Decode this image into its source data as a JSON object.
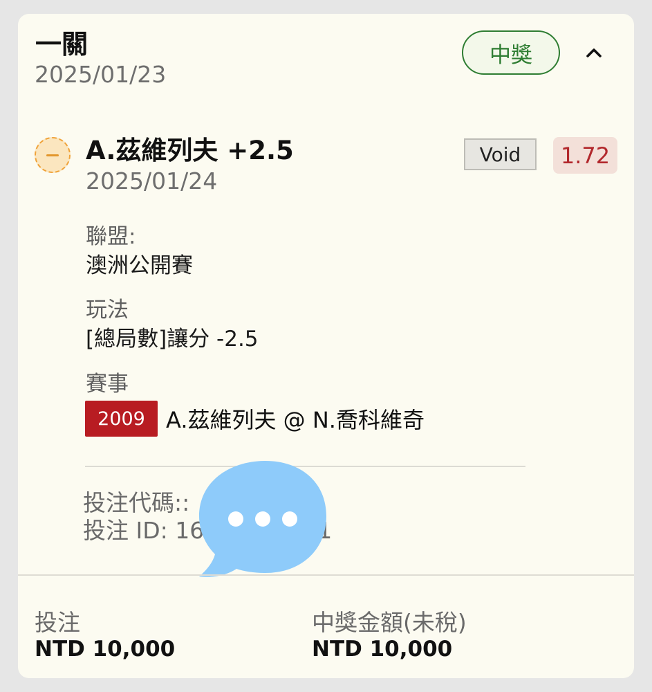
{
  "header": {
    "title": "一關",
    "date": "2025/01/23",
    "status_badge": "中獎"
  },
  "selection": {
    "status_icon": "minus-circle-icon",
    "name": "A.茲維列夫 +2.5",
    "date": "2025/01/24",
    "result_badge": "Void",
    "odds": "1.72"
  },
  "details": {
    "league_label": "聯盟:",
    "league_value": "澳洲公開賽",
    "market_label": "玩法",
    "market_value": "[總局數]讓分 -2.5",
    "event_label": "賽事",
    "event_code": "2009",
    "event_name": "A.茲維列夫 @ N.喬科維奇"
  },
  "bet_info": {
    "bet_code": "投注代碼::",
    "bet_code_tail": "2",
    "bet_id": "投注 ID: 16",
    "bet_id_tail": "1"
  },
  "overlay": {
    "icon": "chat-bubble-icon"
  },
  "footer": {
    "stake_label": "投注",
    "stake_value": "NTD 10,000",
    "payout_label": "中獎金額(未稅)",
    "payout_value": "NTD 10,000"
  },
  "colors": {
    "card_bg": "#fcfbf1",
    "win_green": "#2e7d32",
    "odds_red": "#b2282c",
    "event_code_red": "#b81c22",
    "chat_blue": "#8ecbfa",
    "pending_orange": "#f0a33a"
  }
}
